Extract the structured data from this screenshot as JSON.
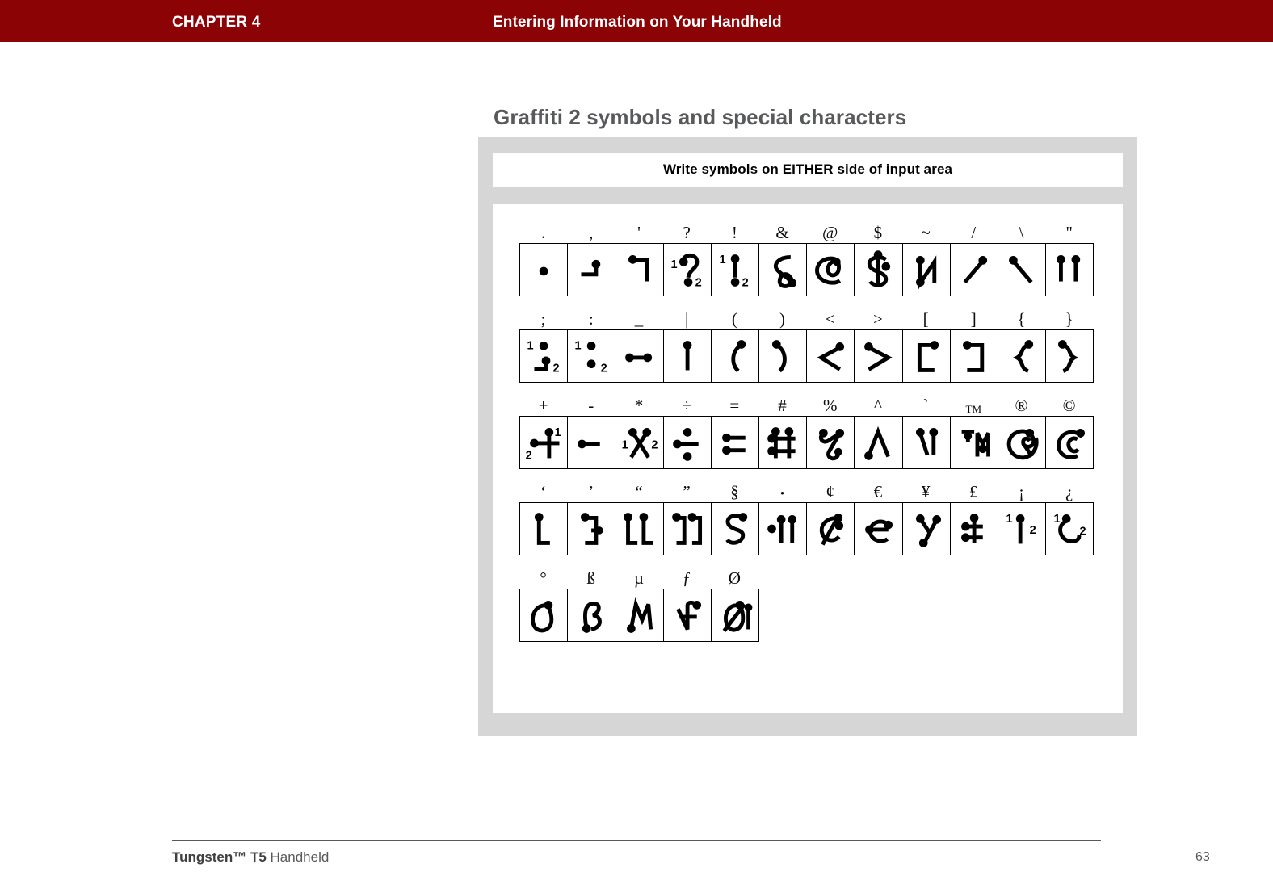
{
  "header": {
    "chapter_label": "CHAPTER 4",
    "chapter_title": "Entering Information on Your Handheld",
    "bar_color": "#8c0306",
    "text_color": "#ffffff"
  },
  "section": {
    "heading": "Graffiti 2 symbols and special characters",
    "heading_color": "#58595b"
  },
  "panel": {
    "banner_text": "Write symbols on EITHER side of input area",
    "background_color": "#d6d6d6",
    "inner_color": "#ffffff"
  },
  "grid": {
    "rows": [
      {
        "row_index": 1,
        "labels": [
          ".",
          ",",
          "'",
          "?",
          "!",
          "&",
          "@",
          "$",
          "~",
          "/",
          "\\",
          "\""
        ],
        "stroke_names": [
          "period",
          "comma",
          "apostrophe",
          "question-mark",
          "exclamation-mark",
          "ampersand",
          "at-sign",
          "dollar-sign",
          "tilde",
          "forward-slash",
          "backslash",
          "double-quote"
        ],
        "stroke_counts": [
          1,
          1,
          1,
          2,
          2,
          1,
          1,
          1,
          1,
          1,
          1,
          2
        ]
      },
      {
        "row_index": 2,
        "labels": [
          ";",
          ":",
          "_",
          "|",
          "(",
          ")",
          "<",
          ">",
          "[",
          "]",
          "{",
          "}"
        ],
        "stroke_names": [
          "semicolon",
          "colon",
          "underscore",
          "pipe",
          "left-paren",
          "right-paren",
          "less-than",
          "greater-than",
          "left-bracket",
          "right-bracket",
          "left-brace",
          "right-brace"
        ],
        "stroke_counts": [
          2,
          2,
          1,
          1,
          1,
          1,
          1,
          1,
          1,
          1,
          1,
          1
        ]
      },
      {
        "row_index": 3,
        "labels": [
          "+",
          "-",
          "*",
          "÷",
          "=",
          "#",
          "%",
          "^",
          "`",
          "TM",
          "®",
          "©"
        ],
        "stroke_names": [
          "plus",
          "minus",
          "asterisk",
          "division-sign",
          "equals",
          "hash",
          "percent",
          "caret",
          "grave-accent",
          "trademark",
          "registered",
          "copyright"
        ],
        "stroke_counts": [
          2,
          1,
          2,
          1,
          1,
          1,
          1,
          1,
          1,
          1,
          1,
          1
        ]
      },
      {
        "row_index": 4,
        "labels": [
          "‘",
          "’",
          "“",
          "”",
          "§",
          "•",
          "¢",
          "€",
          "¥",
          "£",
          "¡",
          "¿"
        ],
        "stroke_names": [
          "left-single-quote",
          "right-single-quote",
          "left-double-quote",
          "right-double-quote",
          "section-sign",
          "bullet",
          "cent-sign",
          "euro-sign",
          "yen-sign",
          "pound-sign",
          "inverted-exclamation",
          "inverted-question"
        ],
        "stroke_counts": [
          1,
          1,
          1,
          1,
          1,
          1,
          1,
          1,
          1,
          1,
          2,
          2
        ]
      },
      {
        "row_index": 5,
        "labels": [
          "°",
          "ß",
          "µ",
          "ƒ",
          "Ø"
        ],
        "stroke_names": [
          "degree-sign",
          "eszett",
          "micro-sign",
          "florin-sign",
          "o-slash"
        ],
        "stroke_counts": [
          1,
          1,
          1,
          1,
          1
        ]
      }
    ]
  },
  "footer": {
    "brand": "Tungsten™ T5",
    "product": " Handheld",
    "page_number": "63",
    "rule_color": "#58595b"
  }
}
